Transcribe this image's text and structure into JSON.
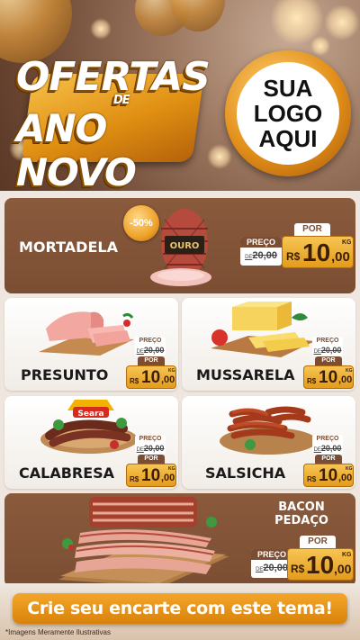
{
  "header": {
    "title_line1": "OFERTAS",
    "title_de": "DE",
    "title_line2": "ANO NOVO",
    "logo_lines": [
      "SUA",
      "LOGO",
      "AQUI"
    ]
  },
  "products": {
    "mortadela": {
      "name": "MORTADELA",
      "badge": "-50%",
      "preco_label": "PREÇO",
      "old_prefix": "DE",
      "old_price": "20,00",
      "por_label": "POR",
      "currency": "R$",
      "price_int": "10",
      "price_cents": ",00",
      "unit": "KG"
    },
    "presunto": {
      "name": "PRESUNTO",
      "preco_label": "PREÇO",
      "old_prefix": "DE",
      "old_price": "20,00",
      "por_label": "POR",
      "currency": "R$",
      "price_int": "10",
      "price_cents": ",00",
      "unit": "KG"
    },
    "mussarela": {
      "name": "MUSSARELA",
      "preco_label": "PREÇO",
      "old_prefix": "DE",
      "old_price": "20,00",
      "por_label": "POR",
      "currency": "R$",
      "price_int": "10",
      "price_cents": ",00",
      "unit": "KG"
    },
    "calabresa": {
      "name": "CALABRESA",
      "brand": "Seara",
      "preco_label": "PREÇO",
      "old_prefix": "DE",
      "old_price": "20,00",
      "por_label": "POR",
      "currency": "R$",
      "price_int": "10",
      "price_cents": ",00",
      "unit": "KG"
    },
    "salsicha": {
      "name": "SALSICHA",
      "preco_label": "PREÇO",
      "old_prefix": "DE",
      "old_price": "20,00",
      "por_label": "POR",
      "currency": "R$",
      "price_int": "10",
      "price_cents": ",00",
      "unit": "KG"
    },
    "bacon": {
      "name_line1": "BACON",
      "name_line2": "PEDAÇO",
      "preco_label": "PREÇO",
      "old_prefix": "DE",
      "old_price": "20,00",
      "por_label": "POR",
      "currency": "R$",
      "price_int": "10",
      "price_cents": ",00",
      "unit": "KG"
    }
  },
  "mortadela_brand": "OURO",
  "footer": {
    "cta": "Crie seu encarte com este tema!",
    "disclaimer": "*Imagens Meramente Ilustrativas"
  },
  "colors": {
    "brown": "#7b4e33",
    "gold": "#e39b1c",
    "cta": "#e08f12",
    "background": "#efe7df"
  }
}
